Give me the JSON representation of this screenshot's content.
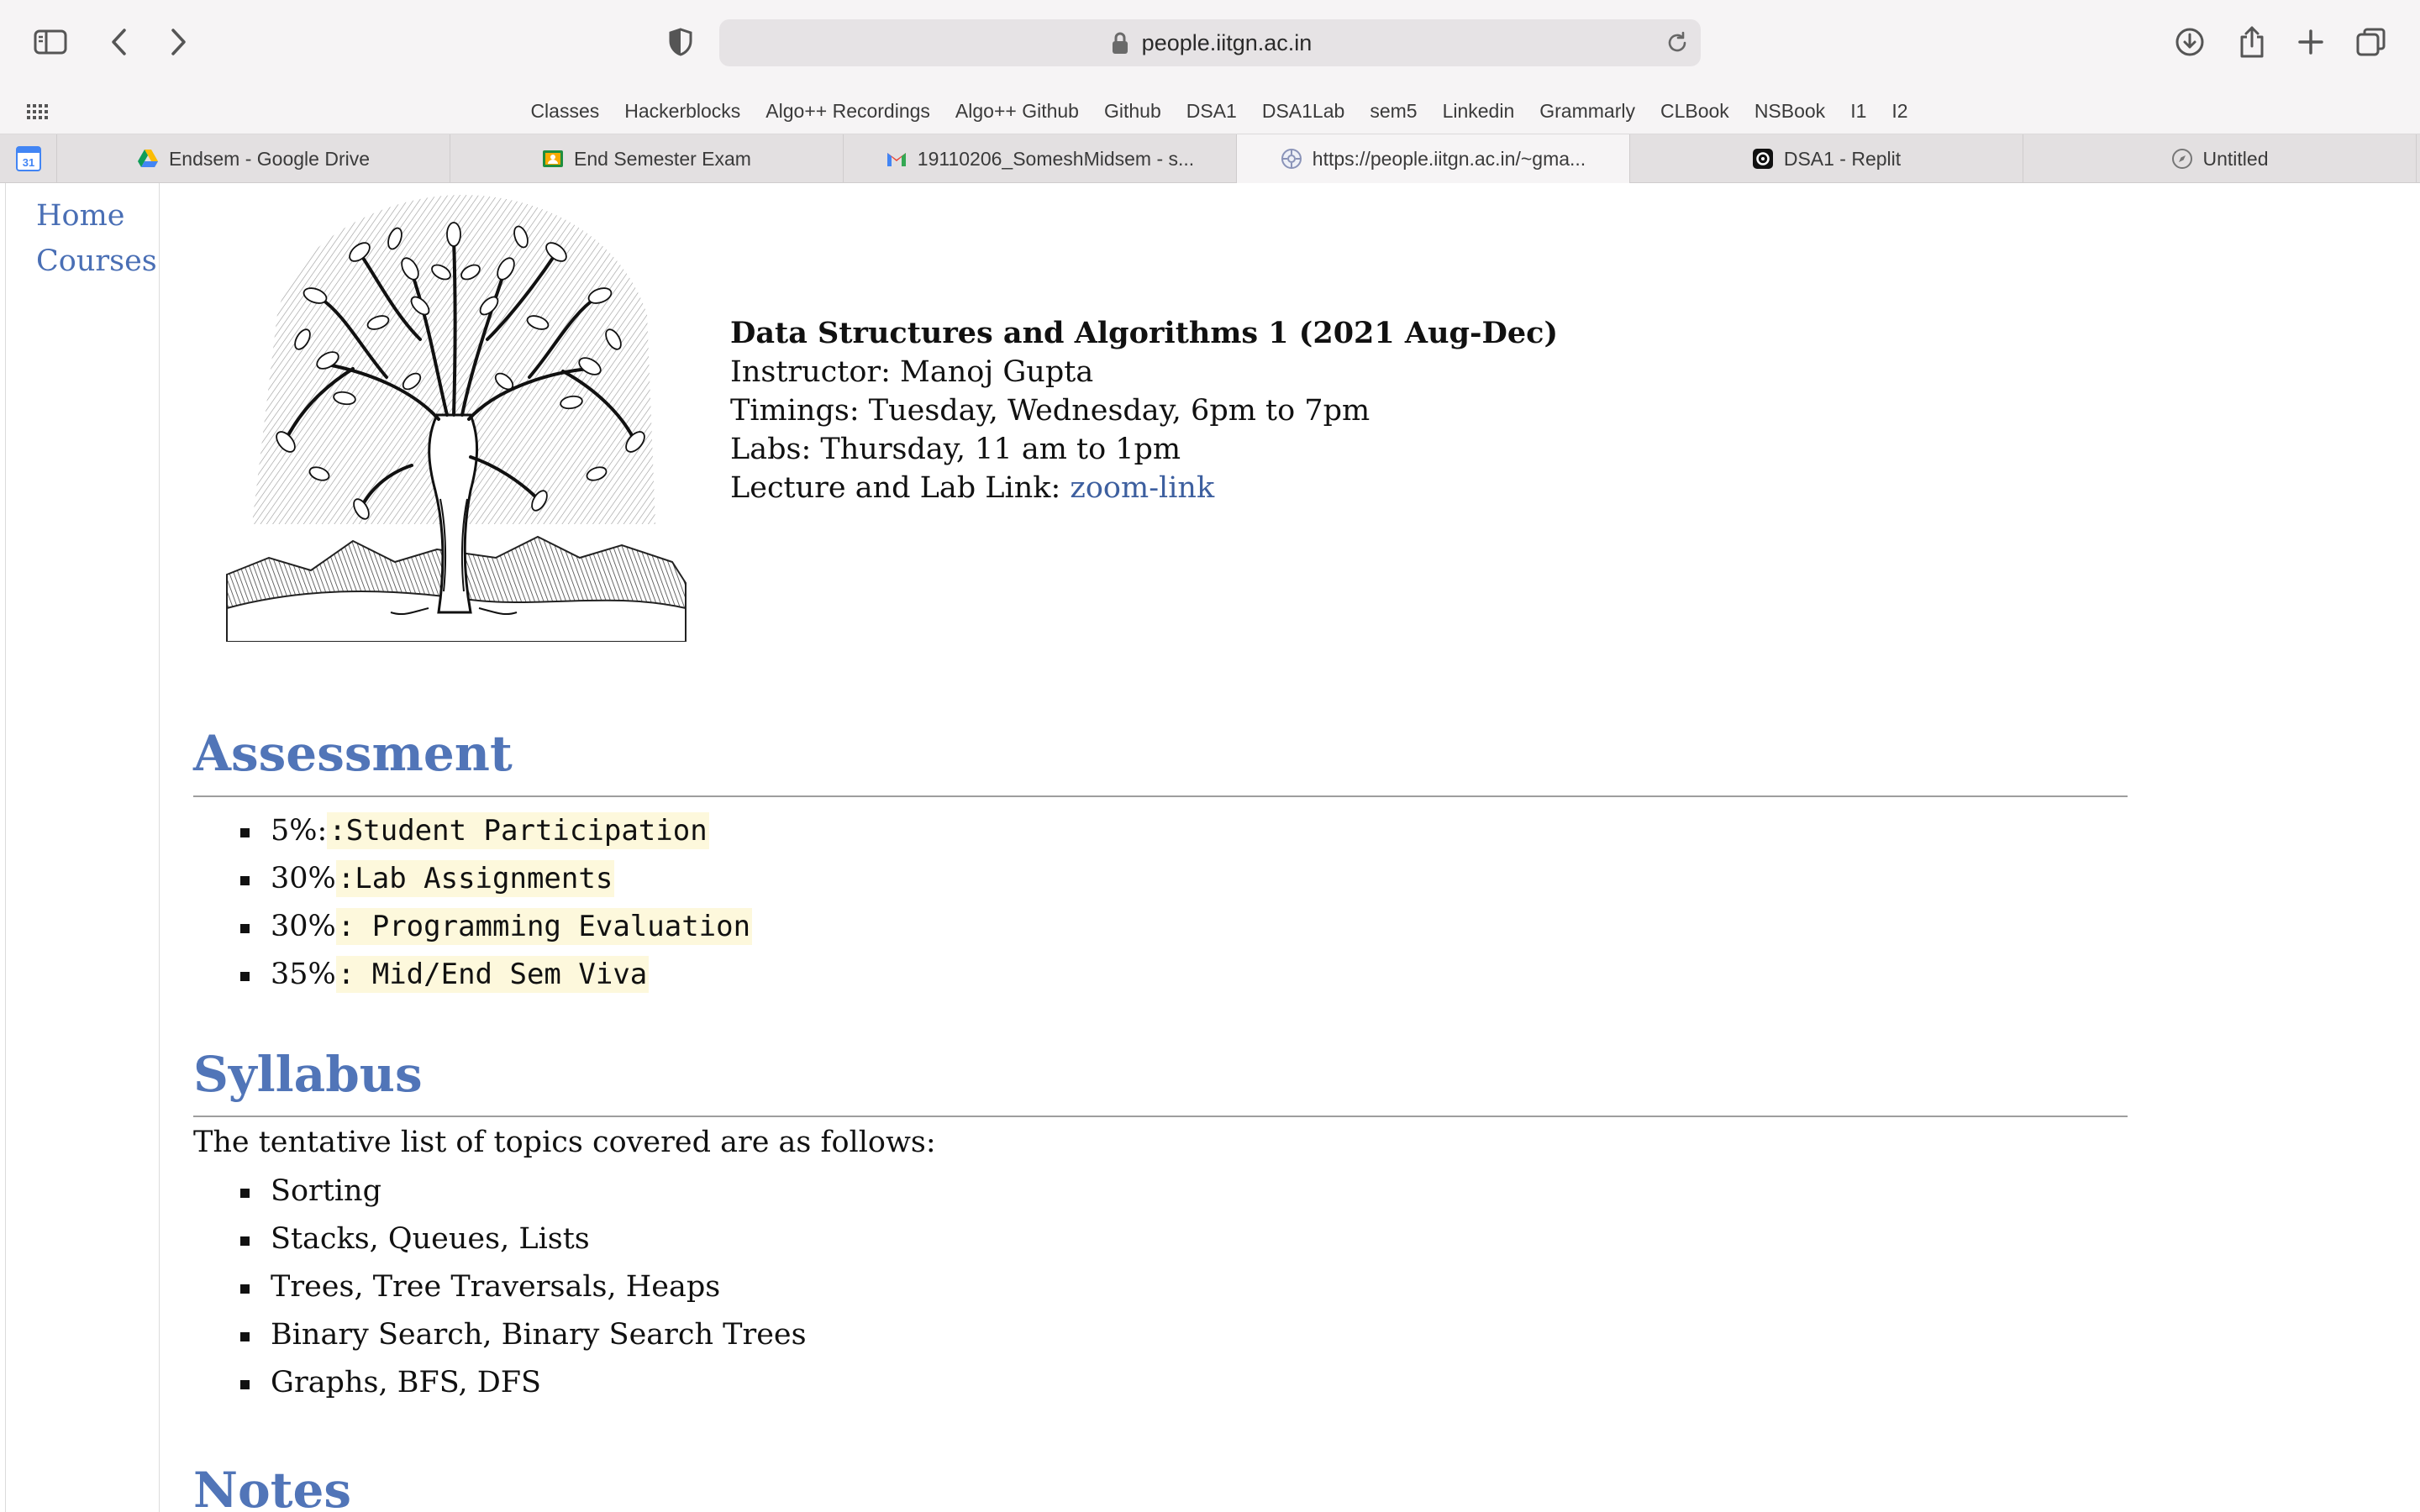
{
  "browser": {
    "url": "people.iitgn.ac.in",
    "bookmarks": [
      "Classes",
      "Hackerblocks",
      "Algo++ Recordings",
      "Algo++ Github",
      "Github",
      "DSA1",
      "DSA1Lab",
      "sem5",
      "Linkedin",
      "Grammarly",
      "CLBook",
      "NSBook",
      "I1",
      "I2"
    ],
    "pinned_tab": {
      "icon": "calendar-icon",
      "label": "31"
    },
    "tabs": [
      {
        "title": "Endsem - Google Drive",
        "icon": "google-drive-icon"
      },
      {
        "title": "End Semester Exam",
        "icon": "google-classroom-icon"
      },
      {
        "title": "19110206_SomeshMidsem - s...",
        "icon": "gmail-icon"
      },
      {
        "title": "https://people.iitgn.ac.in/~gma...",
        "icon": "site-favicon-icon",
        "active": true
      },
      {
        "title": "DSA1 - Replit",
        "icon": "replit-icon"
      },
      {
        "title": "Untitled",
        "icon": "compass-icon"
      }
    ]
  },
  "sidebar": {
    "links": [
      "Home",
      "Courses"
    ]
  },
  "course": {
    "title": "Data Structures and Algorithms 1 (2021 Aug-Dec)",
    "instructor": "Instructor: Manoj Gupta",
    "timings": "Timings: Tuesday, Wednesday, 6pm to 7pm",
    "labs": "Labs: Thursday, 11 am to 1pm",
    "link_prefix": "Lecture and Lab Link: ",
    "link_text": "zoom-link"
  },
  "assessment": {
    "heading": "Assessment",
    "items": [
      {
        "pct": "5%:",
        "label": ":Student Participation"
      },
      {
        "pct": "30%",
        "label": ":Lab Assignments"
      },
      {
        "pct": "30%",
        "label": ": Programming Evaluation"
      },
      {
        "pct": "35%",
        "label": ": Mid/End Sem Viva"
      }
    ]
  },
  "syllabus": {
    "heading": "Syllabus",
    "intro": "The tentative list of topics covered are as follows:",
    "topics": [
      "Sorting",
      "Stacks, Queues, Lists",
      "Trees, Tree Traversals, Heaps",
      "Binary Search, Binary Search Trees",
      "Graphs, BFS, DFS"
    ]
  },
  "notes": {
    "heading": "Notes"
  },
  "colors": {
    "heading": "#5175b8",
    "link": "#4a6fb5",
    "code_bg": "#fdf8dc"
  }
}
